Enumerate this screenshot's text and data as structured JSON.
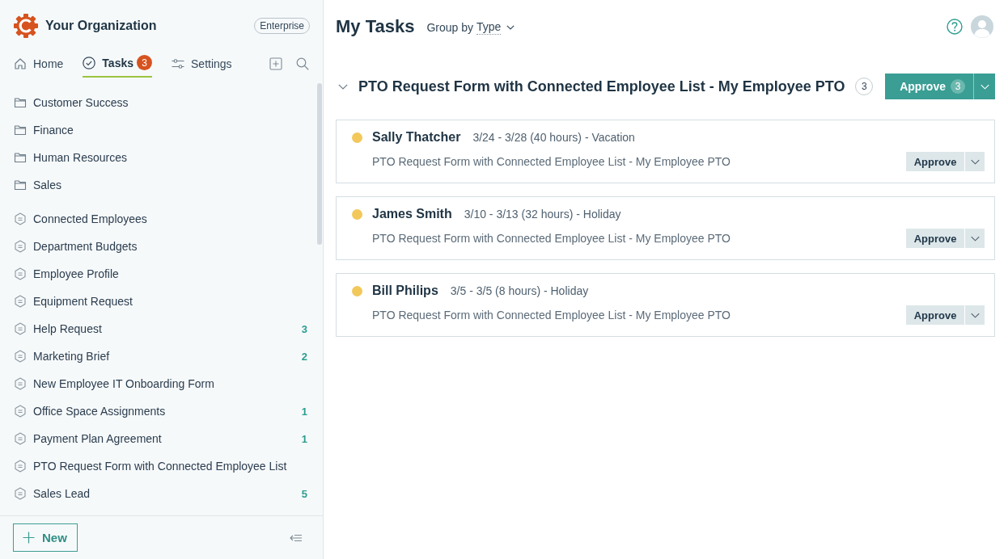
{
  "sidebar": {
    "organization": "Your Organization",
    "plan": "Enterprise",
    "nav": [
      {
        "kind": "home",
        "label": "Home",
        "selected": false
      },
      {
        "kind": "tasks",
        "label": "Tasks",
        "badge": "3",
        "selected": true
      },
      {
        "kind": "settings",
        "label": "Settings",
        "selected": false
      }
    ],
    "folders": [
      {
        "label": "Customer Success"
      },
      {
        "label": "Finance"
      },
      {
        "label": "Human Resources"
      },
      {
        "label": "Sales"
      }
    ],
    "forms": [
      {
        "label": "Connected Employees"
      },
      {
        "label": "Department Budgets"
      },
      {
        "label": "Employee Profile"
      },
      {
        "label": "Equipment Request"
      },
      {
        "label": "Help Request",
        "count": "3"
      },
      {
        "label": "Marketing Brief",
        "count": "2"
      },
      {
        "label": "New Employee IT Onboarding Form"
      },
      {
        "label": "Office Space Assignments",
        "count": "1"
      },
      {
        "label": "Payment Plan Agreement",
        "count": "1"
      },
      {
        "label": "PTO Request Form with Connected Employee List"
      },
      {
        "label": "Sales Lead",
        "count": "5"
      }
    ],
    "new_button": "New"
  },
  "main": {
    "title": "My Tasks",
    "group_by": {
      "label": "Group by",
      "value": "Type"
    },
    "groups": [
      {
        "title": "PTO Request Form with Connected Employee List - My Employee PTO",
        "count": "3",
        "expanded": true,
        "approve_button": {
          "label": "Approve",
          "count": "3"
        },
        "tasks": [
          {
            "name": "Sally Thatcher",
            "details": "3/24 - 3/28 (40 hours) - Vacation",
            "form": "PTO Request Form with Connected Employee List - My Employee PTO",
            "color": "#f2c85b",
            "action": "Approve"
          },
          {
            "name": "James Smith",
            "details": "3/10 - 3/13 (32 hours) - Holiday",
            "form": "PTO Request Form with Connected Employee List - My Employee PTO",
            "color": "#f2c85b",
            "action": "Approve"
          },
          {
            "name": "Bill Philips",
            "details": "3/5 - 3/5 (8 hours) - Holiday",
            "form": "PTO Request Form with Connected Employee List - My Employee PTO",
            "color": "#f2c85b",
            "action": "Approve"
          }
        ]
      }
    ]
  }
}
